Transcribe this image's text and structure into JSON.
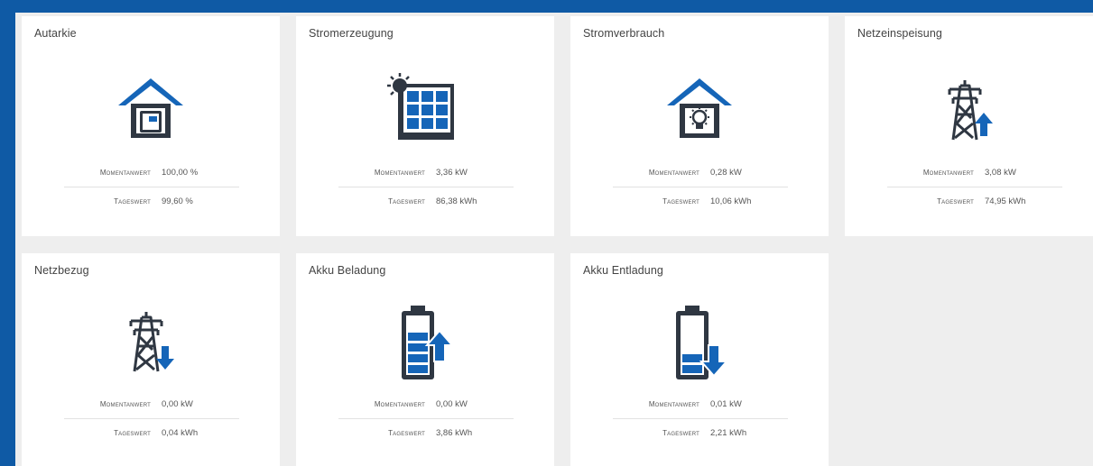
{
  "colors": {
    "frame": "#0f5aa5",
    "icon_dark": "#2f3742",
    "icon_blue": "#1565b8",
    "card_bg": "#ffffff",
    "panel_bg": "#eeeeee"
  },
  "cards": [
    {
      "title": "Autarkie",
      "icon": "house-device-icon",
      "momentanwert_label": "Momentanwert",
      "momentanwert": "100,00 %",
      "tageswert_label": "Tageswert",
      "tageswert": "99,60 %"
    },
    {
      "title": "Stromerzeugung",
      "icon": "solar-panel-icon",
      "momentanwert_label": "Momentanwert",
      "momentanwert": "3,36 kW",
      "tageswert_label": "Tageswert",
      "tageswert": "86,38 kWh"
    },
    {
      "title": "Stromverbrauch",
      "icon": "house-lightbulb-icon",
      "momentanwert_label": "Momentanwert",
      "momentanwert": "0,28 kW",
      "tageswert_label": "Tageswert",
      "tageswert": "10,06 kWh"
    },
    {
      "title": "Netzeinspeisung",
      "icon": "power-tower-up-icon",
      "momentanwert_label": "Momentanwert",
      "momentanwert": "3,08 kW",
      "tageswert_label": "Tageswert",
      "tageswert": "74,95 kWh"
    },
    {
      "title": "Netzbezug",
      "icon": "power-tower-down-icon",
      "momentanwert_label": "Momentanwert",
      "momentanwert": "0,00 kW",
      "tageswert_label": "Tageswert",
      "tageswert": "0,04 kWh"
    },
    {
      "title": "Akku Beladung",
      "icon": "battery-charge-icon",
      "momentanwert_label": "Momentanwert",
      "momentanwert": "0,00 kW",
      "tageswert_label": "Tageswert",
      "tageswert": "3,86 kWh"
    },
    {
      "title": "Akku Entladung",
      "icon": "battery-discharge-icon",
      "momentanwert_label": "Momentanwert",
      "momentanwert": "0,01 kW",
      "tageswert_label": "Tageswert",
      "tageswert": "2,21 kWh"
    }
  ]
}
